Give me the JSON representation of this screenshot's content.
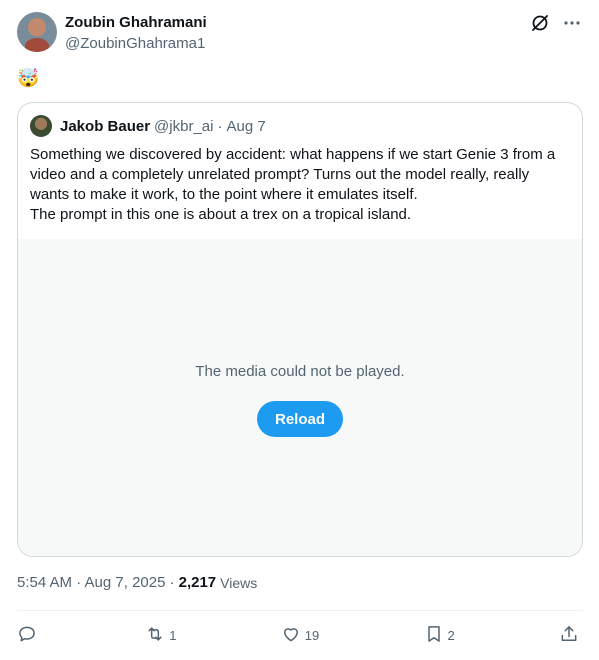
{
  "tweet": {
    "author_name": "Zoubin Ghahramani",
    "author_handle": "@ZoubinGhahrama1",
    "text": "🤯",
    "timestamp": "5:54 AM · Aug 7, 2025 ·",
    "views_count": "2,217",
    "views_label": "Views"
  },
  "quoted": {
    "author_name": "Jakob Bauer",
    "author_handle": "@jkbr_ai",
    "separator": "·",
    "date": "Aug 7",
    "line1": "Something we discovered by accident: what happens if we start Genie 3 from a video and a completely unrelated prompt? Turns out the model really, really wants to make it work, to the point where it emulates itself.",
    "line2": "The prompt in this one is about a trex on a tropical island.",
    "media_error": "The media could not be played.",
    "reload_label": "Reload"
  },
  "actions": {
    "reply_count": "",
    "retweet_count": "1",
    "like_count": "19",
    "bookmark_count": "2"
  },
  "icons": [
    "grok-icon",
    "more-icon",
    "reply-icon",
    "retweet-icon",
    "like-icon",
    "bookmark-icon",
    "share-icon"
  ],
  "colors": {
    "accent": "#1d9bf0",
    "muted": "#536471",
    "text": "#0f1419",
    "border": "#cfd9de"
  }
}
